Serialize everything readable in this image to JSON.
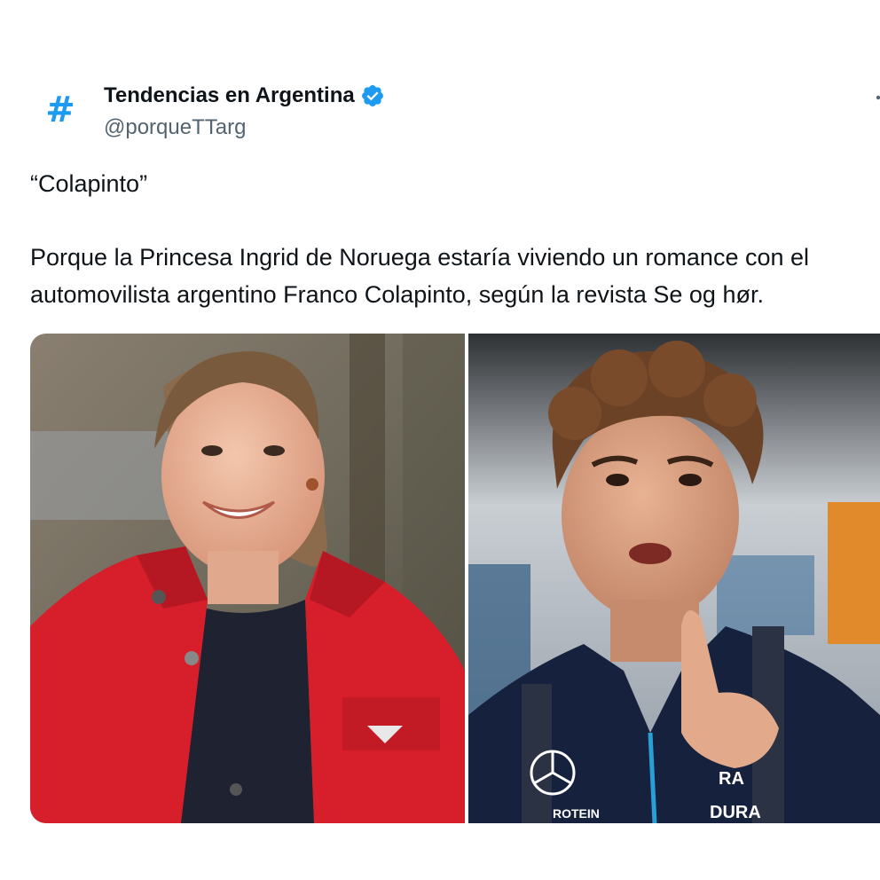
{
  "account": {
    "avatar_glyph": "#",
    "display_name": "Tendencias en Argentina",
    "handle": "@porqueTTarg",
    "verified": true
  },
  "tweet": {
    "lines": [
      "“Colapinto”",
      "Porque la Princesa Ingrid de Noruega estaría viviendo un romance con el",
      "automovilista argentino Franco Colapinto, según la revista Se og hør."
    ]
  },
  "media": {
    "images": [
      {
        "icon": "photo-woman-red-jacket"
      },
      {
        "icon": "photo-man-racing-jacket",
        "jacket_text": [
          "RA",
          "DURA",
          "ROTEIN"
        ]
      }
    ]
  },
  "colors": {
    "accent": "#1d9bf0",
    "text": "#0f1419",
    "secondary": "#536471"
  }
}
